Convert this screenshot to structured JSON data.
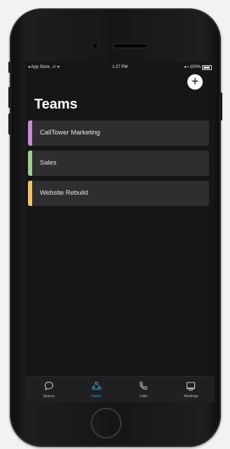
{
  "status_bar": {
    "carrier": "◂ App Store ..ıl ᯤ",
    "time": "1:27 PM",
    "battery": "◂ ▪ 100%"
  },
  "header": {
    "add_symbol": "+"
  },
  "page_title": "Teams",
  "teams": [
    {
      "name": "CallTower Marketing",
      "color": "#c98ad6"
    },
    {
      "name": "Sales",
      "color": "#9fd08e"
    },
    {
      "name": "Website Rebuild",
      "color": "#f2c46a"
    }
  ],
  "tabs": [
    {
      "label": "Spaces",
      "icon": "chat-bubble-icon",
      "active": false
    },
    {
      "label": "Teams",
      "icon": "teams-icon",
      "active": true
    },
    {
      "label": "Calls",
      "icon": "phone-icon",
      "active": false
    },
    {
      "label": "Meetings",
      "icon": "calendar-icon",
      "active": false
    }
  ],
  "colors": {
    "accent": "#3aa0d8",
    "background": "#161618",
    "card": "#2e2e30"
  }
}
